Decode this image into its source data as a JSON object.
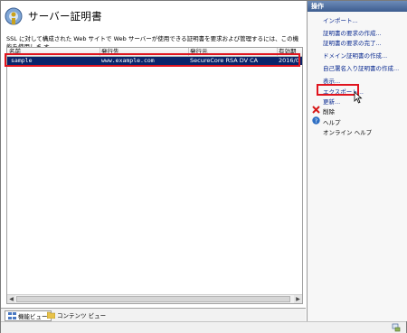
{
  "page": {
    "title": "サーバー証明書",
    "description": "SSL に対して構成された Web サイトで Web サーバーが使用できる証明書を要求および管理するには、この機能を使用しま す。"
  },
  "table": {
    "columns": [
      "名前",
      "発行先",
      "発行元",
      "有効期"
    ],
    "rows": [
      {
        "name": "sample",
        "issued_to": "www.example.com",
        "issuer": "SecureCore RSA DV CA",
        "expiry": "2016/0"
      }
    ]
  },
  "bottom_tabs": [
    {
      "label": "機能ビュー",
      "icon": "feature-view-icon",
      "active": true
    },
    {
      "label": "コンテンツ ビュー",
      "icon": "content-view-icon",
      "active": false
    }
  ],
  "actions": {
    "header": "操作",
    "items": [
      {
        "label": "インポート..."
      },
      {
        "label": "証明書の要求の作成..."
      },
      {
        "label": "証明書の要求の完了..."
      },
      {
        "label": "ドメイン証明書の作成..."
      },
      {
        "label": "自己署名入り証明書の作成..."
      },
      {
        "label": "表示..."
      },
      {
        "label": "エクスポート..."
      },
      {
        "label": "更新..."
      },
      {
        "label": "削除"
      },
      {
        "label": "ヘルプ"
      },
      {
        "label": "オンライン ヘルプ"
      }
    ]
  },
  "colors": {
    "selection": "#0a246a",
    "highlight_box": "#e0141e",
    "actions_header": "#3d5d8f"
  }
}
